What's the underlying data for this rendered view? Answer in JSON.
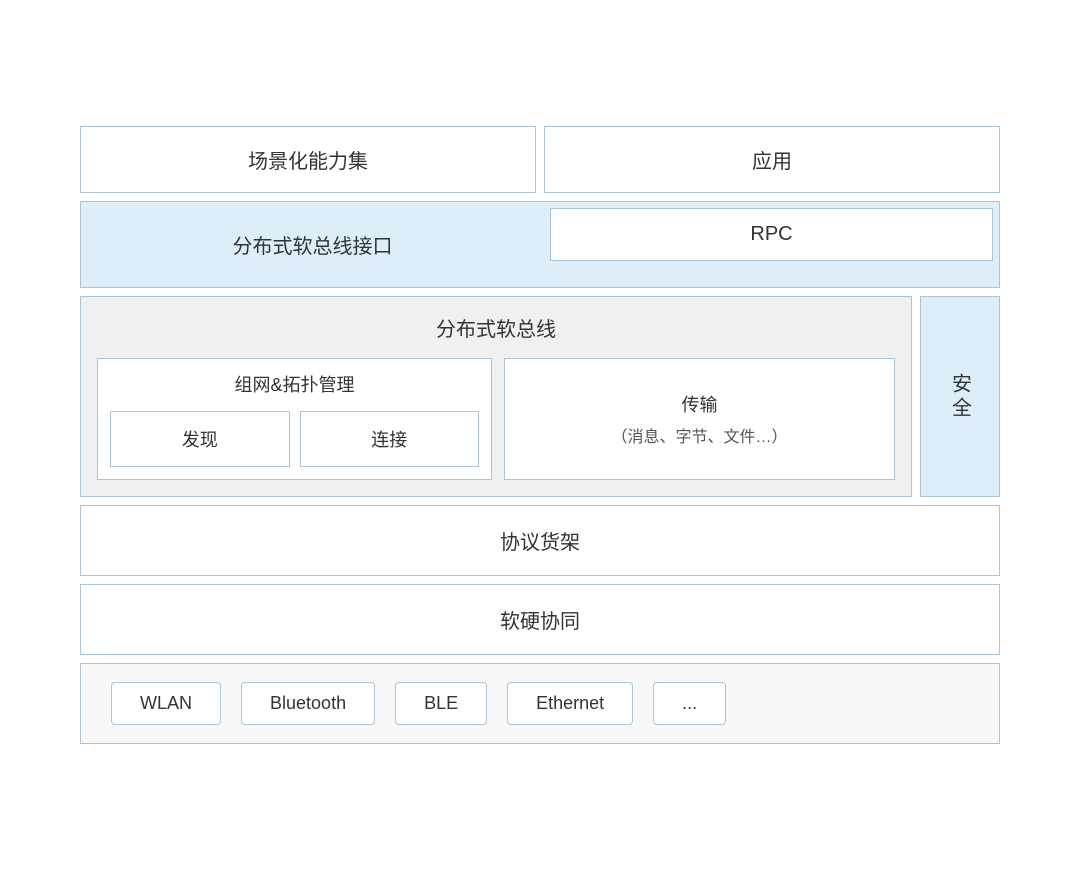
{
  "top": {
    "scene_label": "场景化能力集",
    "app_label": "应用"
  },
  "interface": {
    "label": "分布式软总线接口",
    "rpc_label": "RPC"
  },
  "softbus": {
    "title": "分布式软总线",
    "network": {
      "title": "组网&拓扑管理",
      "discover": "发现",
      "connect": "连接"
    },
    "transport": {
      "title": "传输",
      "subtitle": "（消息、字节、文件…）"
    },
    "security": "安全"
  },
  "protocol": {
    "label": "协议货架"
  },
  "hw": {
    "label": "软硬协同"
  },
  "hardware": {
    "chips": [
      {
        "label": "WLAN"
      },
      {
        "label": "Bluetooth"
      },
      {
        "label": "BLE"
      },
      {
        "label": "Ethernet"
      },
      {
        "label": "..."
      }
    ]
  }
}
